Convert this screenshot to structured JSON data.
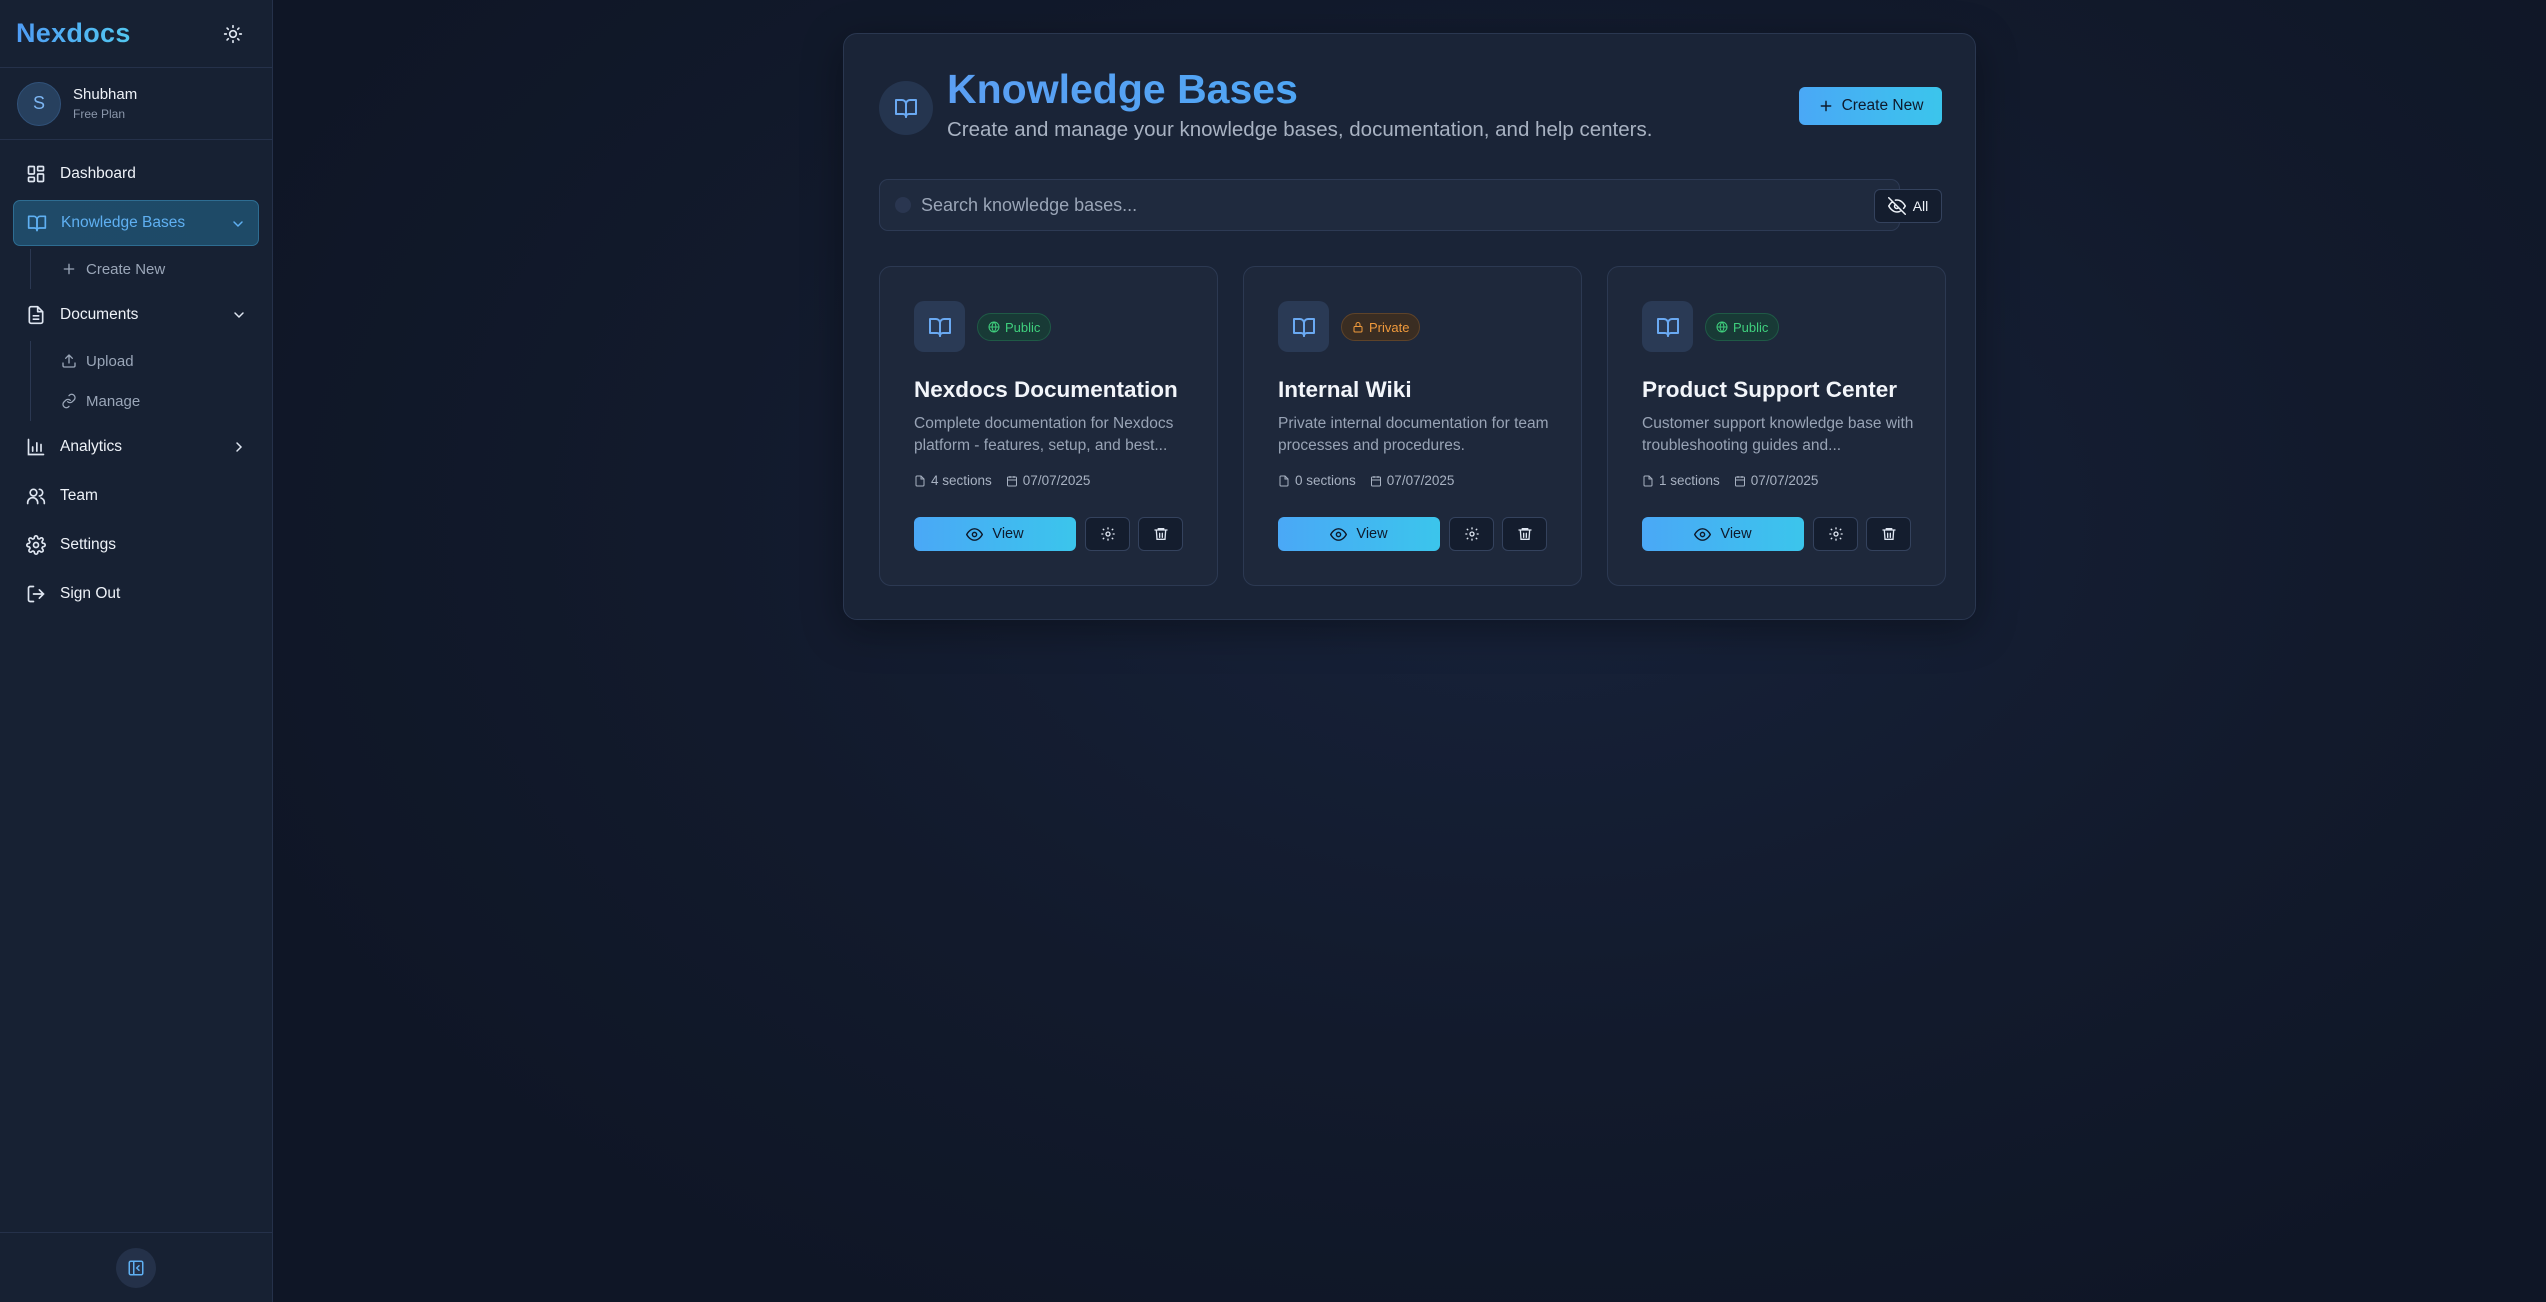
{
  "sidebar": {
    "brand": "Nexdocs",
    "user": {
      "initial": "S",
      "name": "Shubham",
      "plan": "Free Plan"
    },
    "nav": {
      "dashboard": "Dashboard",
      "knowledge_bases": "Knowledge Bases",
      "kb_create_new": "Create New",
      "documents": "Documents",
      "doc_upload": "Upload",
      "doc_manage": "Manage",
      "analytics": "Analytics",
      "team": "Team",
      "settings": "Settings",
      "sign_out": "Sign Out"
    }
  },
  "main": {
    "title": "Knowledge Bases",
    "subtitle": "Create and manage your knowledge bases, documentation, and help centers.",
    "create_button": "Create New",
    "search_placeholder": "Search knowledge bases...",
    "filter_label": "All",
    "cards": [
      {
        "visibility": "Public",
        "title": "Nexdocs Documentation",
        "description": "Complete documentation for Nexdocs platform - features, setup, and best...",
        "sections": "4 sections",
        "date": "07/07/2025",
        "view_label": "View"
      },
      {
        "visibility": "Private",
        "title": "Internal Wiki",
        "description": "Private internal documentation for team processes and procedures.",
        "sections": "0 sections",
        "date": "07/07/2025",
        "view_label": "View"
      },
      {
        "visibility": "Public",
        "title": "Product Support Center",
        "description": "Customer support knowledge base with troubleshooting guides and...",
        "sections": "1 sections",
        "date": "07/07/2025",
        "view_label": "View"
      }
    ]
  },
  "colors": {
    "background": "#121a2c",
    "sidebar": "#172133",
    "accent": "#4aa8f6",
    "accent_cyan": "#3bc5ec",
    "public_badge": "#3fcf7d",
    "private_badge": "#f09a3c"
  },
  "icons": {
    "theme": "sun-icon",
    "dashboard": "grid-icon",
    "knowledge_bases": "book-icon",
    "documents": "file-icon",
    "analytics": "bar-chart-icon",
    "team": "users-icon",
    "settings": "gear-icon",
    "sign_out": "logout-icon",
    "collapse": "sidebar-collapse-icon"
  }
}
